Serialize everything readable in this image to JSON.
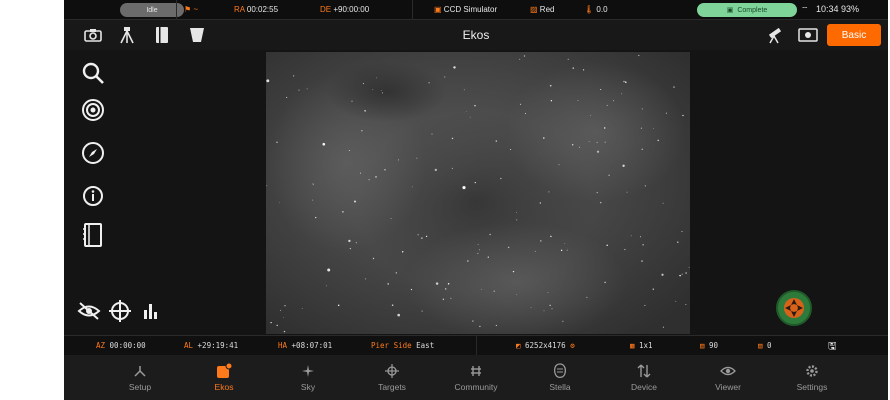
{
  "status": {
    "state": "Idle",
    "ra_label": "RA",
    "ra_value": "00:02:55",
    "de_label": "DE",
    "de_value": "+90:00:00",
    "guide_value": "~",
    "camera": "CCD Simulator",
    "filter": "Red",
    "temperature": "0.0",
    "job_state": "Complete",
    "clock": "10:34",
    "battery": "93%"
  },
  "toolbar": {
    "title": "Ekos",
    "basic_label": "Basic"
  },
  "infobar": {
    "az_label": "AZ",
    "az_value": "00:00:00",
    "al_label": "AL",
    "al_value": "+29:19:41",
    "ha_label": "HA",
    "ha_value": "+08:07:01",
    "pier_label": "Pier Side",
    "pier_value": "East",
    "resolution": "6252x4176",
    "binning": "1x1",
    "exposures": "90",
    "captured": "0"
  },
  "nav": [
    {
      "label": "Setup",
      "icon": "setup-icon",
      "active": false
    },
    {
      "label": "Ekos",
      "icon": "ekos-icon",
      "active": true
    },
    {
      "label": "Sky",
      "icon": "sky-icon",
      "active": false
    },
    {
      "label": "Targets",
      "icon": "targets-icon",
      "active": false
    },
    {
      "label": "Community",
      "icon": "community-icon",
      "active": false
    },
    {
      "label": "Stella",
      "icon": "stella-icon",
      "active": false
    },
    {
      "label": "Device",
      "icon": "device-icon",
      "active": false
    },
    {
      "label": "Viewer",
      "icon": "viewer-icon",
      "active": false
    },
    {
      "label": "Settings",
      "icon": "settings-icon",
      "active": false
    }
  ],
  "colors": {
    "accent": "#ff6a00",
    "complete": "#7fd49a",
    "mount_green": "#2e7a3a"
  }
}
